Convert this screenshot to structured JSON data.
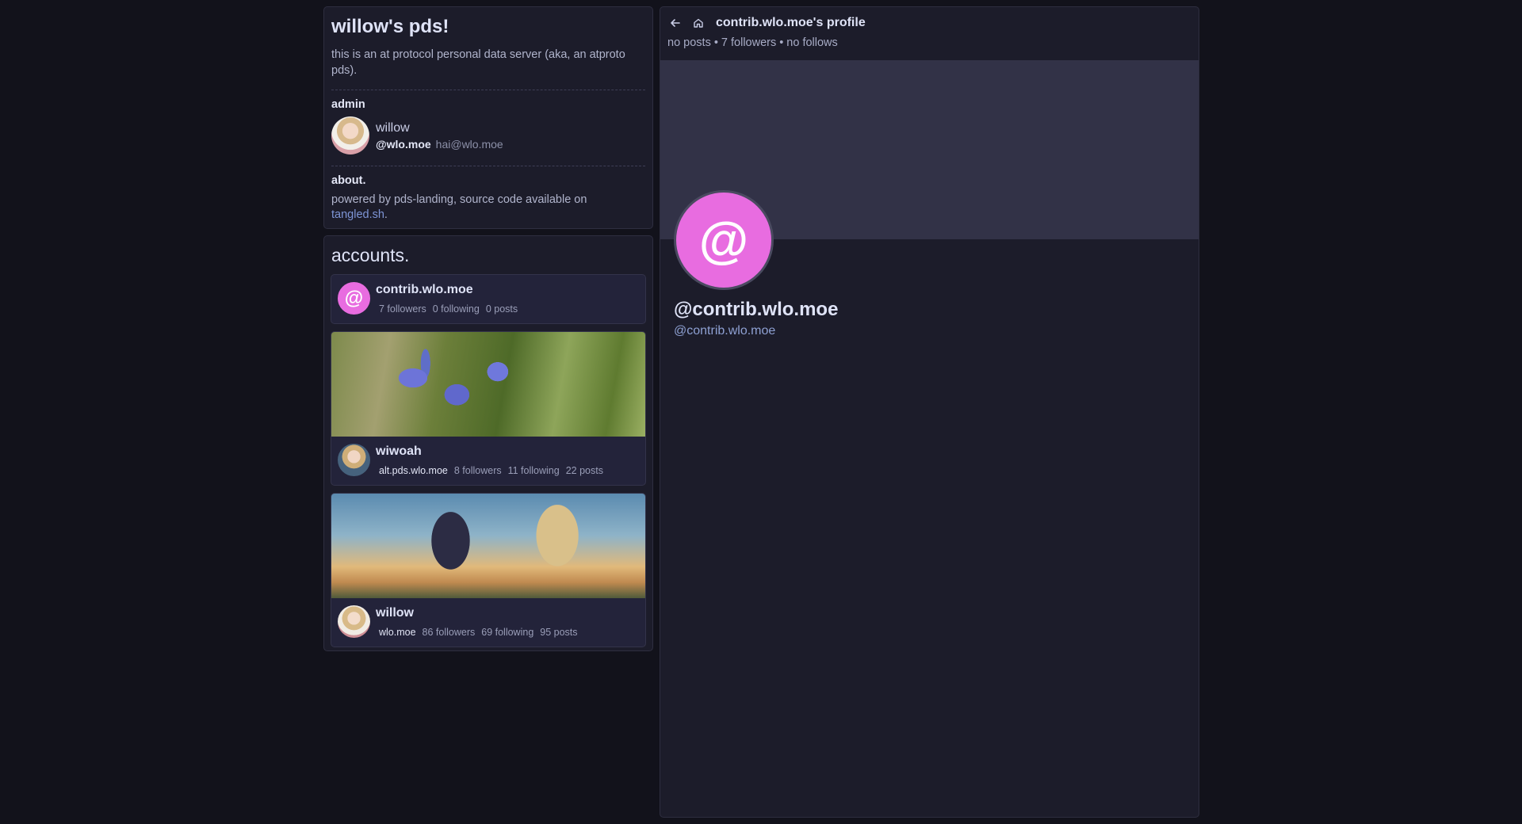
{
  "info": {
    "title": "willow's pds!",
    "description": "this is an at protocol personal data server (aka, an atproto pds).",
    "admin_label": "admin",
    "admin": {
      "name": "willow",
      "handle": "@wlo.moe",
      "email": "hai@wlo.moe"
    },
    "about_label": "about.",
    "about_text": "powered by pds-landing, source code available on",
    "about_link": "tangled.sh",
    "about_end": "."
  },
  "accounts": {
    "title": "accounts.",
    "items": [
      {
        "name": "contrib.wlo.moe",
        "handle": "",
        "followers": "7 followers",
        "following": "0 following",
        "posts": "0 posts",
        "avatar_glyph": "@"
      },
      {
        "name": "wiwoah",
        "handle": "alt.pds.wlo.moe",
        "followers": "8 followers",
        "following": "11 following",
        "posts": "22 posts"
      },
      {
        "name": "willow",
        "handle": "wlo.moe",
        "followers": "86 followers",
        "following": "69 following",
        "posts": "95 posts"
      }
    ]
  },
  "profile": {
    "header_title": "contrib.wlo.moe's profile",
    "posts": "no posts",
    "followers": "7 followers",
    "follows": "no follows",
    "sep": "•",
    "avatar_glyph": "@",
    "display_handle": "@contrib.wlo.moe",
    "handle": "@contrib.wlo.moe"
  },
  "colors": {
    "background": "#12121b",
    "panel": "#1c1c2a",
    "accent_avatar": "#e86ce0",
    "link": "#7e95d6"
  },
  "icons": {
    "back": "arrow-left-icon",
    "home": "home-icon"
  }
}
